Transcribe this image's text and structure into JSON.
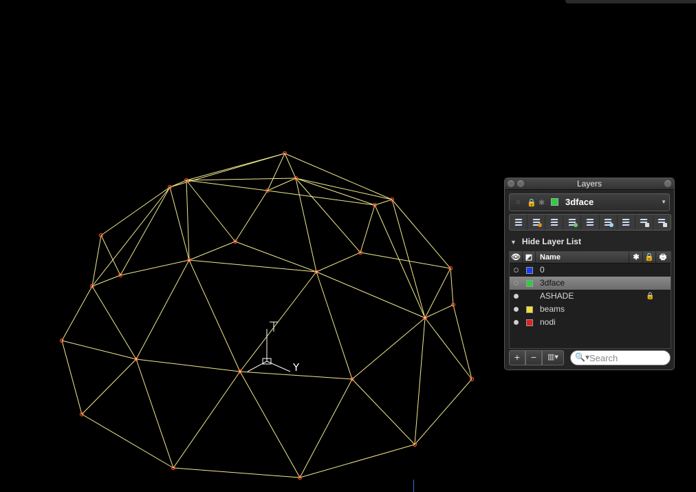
{
  "viewport": {
    "name": "3D geodesic dome wireframe",
    "ucs_label": "Y",
    "colors": {
      "background": "#000000",
      "edges": "#f3eb8e",
      "nodes": "#e8502a"
    }
  },
  "layers_panel": {
    "title": "Layers",
    "current_layer": {
      "name": "3dface",
      "color": "#2ecc40"
    },
    "hide_list_label": "Hide Layer List",
    "columns": {
      "name": "Name"
    },
    "layers": [
      {
        "name": "0",
        "color": "#1a3cff",
        "visible": false,
        "locked": false,
        "selected": false
      },
      {
        "name": "3dface",
        "color": "#2ecc40",
        "visible": false,
        "locked": false,
        "selected": true
      },
      {
        "name": "ASHADE",
        "color": "",
        "visible": true,
        "locked": true,
        "selected": false
      },
      {
        "name": "beams",
        "color": "#f2e22b",
        "visible": true,
        "locked": false,
        "selected": false
      },
      {
        "name": "nodi",
        "color": "#e02020",
        "visible": true,
        "locked": false,
        "selected": false
      }
    ],
    "bottom": {
      "add": "+",
      "remove": "−",
      "columns_menu": "▥▾"
    },
    "search": {
      "placeholder": "Search"
    }
  }
}
